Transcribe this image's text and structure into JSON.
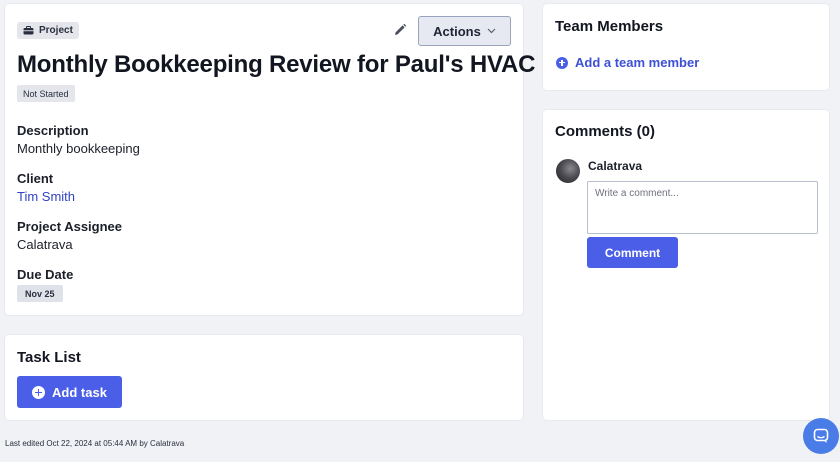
{
  "project": {
    "type_label": "Project",
    "actions_label": "Actions",
    "title": "Monthly Bookkeeping Review for Paul's HVAC",
    "status": "Not Started",
    "fields": {
      "description_label": "Description",
      "description_value": "Monthly bookkeeping",
      "client_label": "Client",
      "client_value": "Tim Smith",
      "assignee_label": "Project Assignee",
      "assignee_value": "Calatrava",
      "due_label": "Due Date",
      "due_value": "Nov 25"
    }
  },
  "tasks": {
    "title": "Task List",
    "add_label": "Add task"
  },
  "team": {
    "title": "Team Members",
    "add_label": "Add a team member"
  },
  "comments": {
    "title": "Comments (0)",
    "user": "Calatrava",
    "placeholder": "Write a comment...",
    "submit_label": "Comment"
  },
  "footer": {
    "last_edited": "Last edited Oct 22, 2024 at 05:44 AM by Calatrava"
  },
  "icons": {
    "project": "briefcase-icon",
    "edit": "pencil-icon",
    "actions": "chevron-down-icon",
    "add": "plus-circle-icon",
    "chat": "chat-icon"
  },
  "colors": {
    "accent": "#4a5ee8",
    "link": "#2f43c4",
    "chip_bg": "#e4e6ec",
    "page_bg": "#f1f2f6"
  }
}
